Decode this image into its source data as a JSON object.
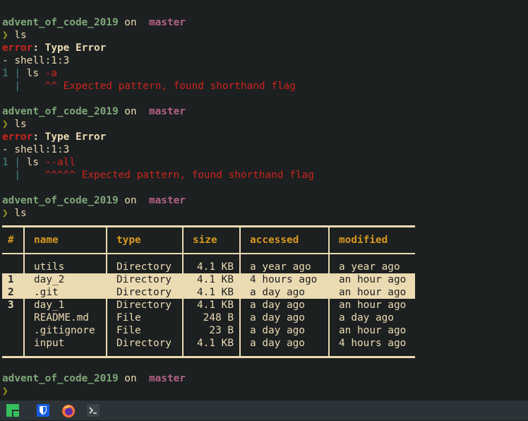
{
  "prompt": {
    "dir": "advent_of_code_2019",
    "on": "on",
    "branch_icon": "",
    "branch": "master",
    "chevron": "❯"
  },
  "blocks": [
    {
      "command": "ls",
      "error_label": "error",
      "error_title": ": Type Error",
      "location": "- shell:1:3",
      "line_no": "1",
      "code_cmd": "ls ",
      "code_flag": "-a",
      "carets": "^^",
      "message": "Expected pattern, found shorthand flag"
    },
    {
      "command": "ls",
      "error_label": "error",
      "error_title": ": Type Error",
      "location": "- shell:1:3",
      "line_no": "1",
      "code_cmd": "ls ",
      "code_flag": "--all",
      "carets": "^^^^^",
      "message": "Expected pattern, found shorthand flag"
    }
  ],
  "third_command": "ls",
  "table": {
    "headers": {
      "idx": "#",
      "name": "name",
      "type": "type",
      "size": "size",
      "accessed": "accessed",
      "modified": "modified"
    },
    "rows": [
      {
        "idx": "",
        "name": "utils",
        "type": "Directory",
        "size": "4.1 KB",
        "accessed": "a year ago",
        "modified": "a year ago"
      },
      {
        "idx": "1",
        "name": "day_2",
        "type": "Directory",
        "size": "4.1 KB",
        "accessed": "4 hours ago",
        "modified": "an hour ago"
      },
      {
        "idx": "2",
        "name": ".git",
        "type": "Directory",
        "size": "4.1 KB",
        "accessed": "a day ago",
        "modified": "an hour ago"
      },
      {
        "idx": "3",
        "name": "day_1",
        "type": "Directory",
        "size": "4.1 KB",
        "accessed": "a day ago",
        "modified": "an hour ago"
      },
      {
        "idx": "",
        "name": "README.md",
        "type": "File",
        "size": "248 B",
        "accessed": "a day ago",
        "modified": "a day ago"
      },
      {
        "idx": "",
        "name": ".gitignore",
        "type": "File",
        "size": "23 B",
        "accessed": "a day ago",
        "modified": "an hour ago"
      },
      {
        "idx": "",
        "name": "input",
        "type": "Directory",
        "size": "4.1 KB",
        "accessed": "a day ago",
        "modified": "4 hours ago"
      }
    ]
  },
  "taskbar": {
    "icons": [
      "manjaro-icon",
      "bitwarden-icon",
      "firefox-icon",
      "terminal-icon"
    ],
    "colors": {
      "manjaro": "#35bf5c",
      "bitwarden": "#175ddc",
      "firefox": "#ff7139",
      "terminal": "#3c4448"
    }
  }
}
